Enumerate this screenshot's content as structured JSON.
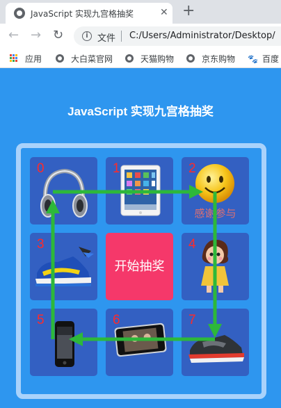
{
  "browser": {
    "tab_title": "JavaScript 实现九宫格抽奖",
    "tab_close": "✕",
    "new_tab": "+",
    "omnibox_label": "文件",
    "url": "C:/Users/Administrator/Desktop/",
    "nav": {
      "back": "←",
      "forward": "→",
      "reload": "↻"
    },
    "info": "i",
    "bookmarks": [
      "应用",
      "大白菜官网",
      "天猫购物",
      "京东购物",
      "百度"
    ]
  },
  "page": {
    "title": "JavaScript 实现九宫格抽奖",
    "start_button": "开始抽奖",
    "cells": [
      {
        "num": "0",
        "prize": "headphones"
      },
      {
        "num": "1",
        "prize": "ipad"
      },
      {
        "num": "2",
        "prize": "smiley",
        "label": "感谢参与"
      },
      {
        "num": "3",
        "prize": "sneaker"
      },
      {
        "num": "4",
        "prize": "doll"
      },
      {
        "num": "5",
        "prize": "iphone"
      },
      {
        "num": "6",
        "prize": "ipod"
      },
      {
        "num": "7",
        "prize": "shoe"
      }
    ]
  },
  "colors": {
    "page_bg": "#2e96ef",
    "cell_bg": "#3360c2",
    "board_border": "#a9d2fb",
    "start_button_bg": "#f5386a",
    "cell_number": "#ff2a2a",
    "arrow": "#2db83a"
  }
}
